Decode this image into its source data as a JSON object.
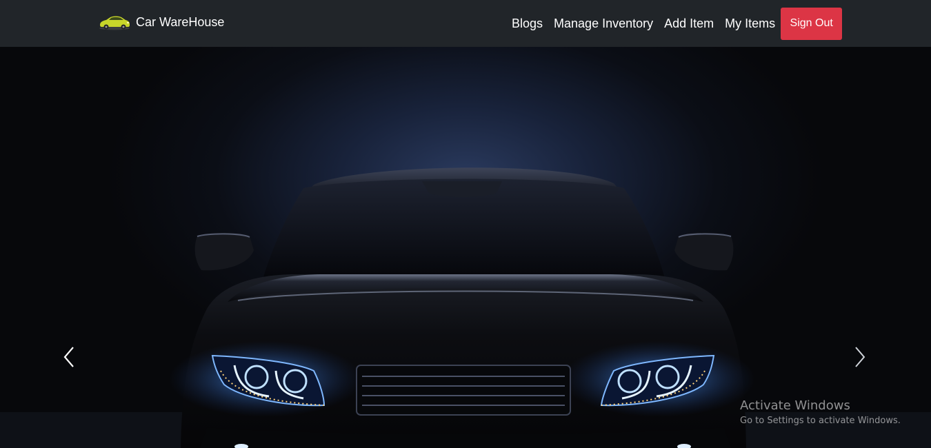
{
  "navbar": {
    "brand": {
      "logo_icon": "yellow-car-logo",
      "name": "Car WareHouse"
    },
    "links": [
      {
        "label": "Blogs"
      },
      {
        "label": "Manage Inventory"
      },
      {
        "label": "Add Item"
      },
      {
        "label": "My Items"
      }
    ],
    "signout_label": "Sign Out",
    "signout_color": "#dc3545",
    "background": "#212529"
  },
  "carousel": {
    "slide_image": "black-car-front-blue-headlights",
    "prev_icon": "chevron-left-icon",
    "next_icon": "chevron-right-icon"
  },
  "watermark": {
    "title": "Activate Windows",
    "subtitle": "Go to Settings to activate Windows."
  }
}
